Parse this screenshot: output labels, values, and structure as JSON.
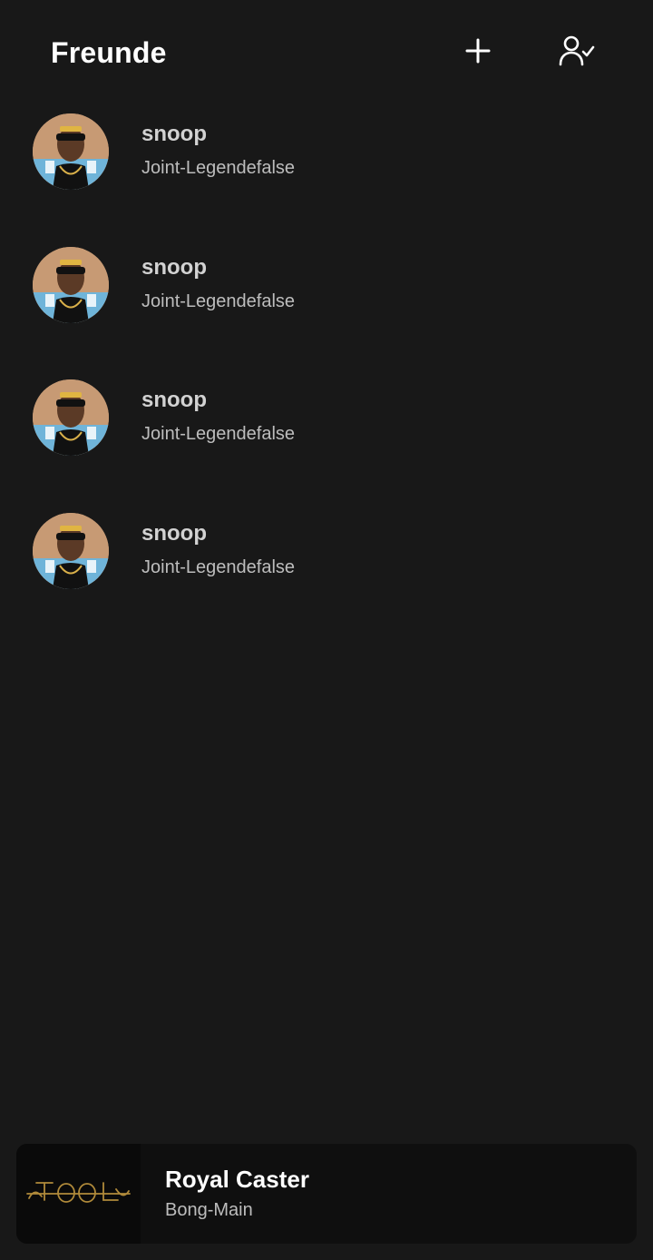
{
  "header": {
    "title": "Freunde",
    "add_icon": "plus-icon",
    "friends_icon": "user-check-icon"
  },
  "friends": [
    {
      "name": "snoop",
      "status": "Joint-Legendefalse",
      "avatar_icon": "avatar-photo"
    },
    {
      "name": "snoop",
      "status": "Joint-Legendefalse",
      "avatar_icon": "avatar-photo"
    },
    {
      "name": "snoop",
      "status": "Joint-Legendefalse",
      "avatar_icon": "avatar-photo"
    },
    {
      "name": "snoop",
      "status": "Joint-Legendefalse",
      "avatar_icon": "avatar-photo"
    }
  ],
  "player": {
    "title": "Royal Caster",
    "artist": "Bong-Main",
    "cover_logo": "TOOL"
  },
  "colors": {
    "background": "#181818",
    "player_background": "#0f0f0f",
    "text_primary": "#ffffff",
    "text_secondary": "#bdbdbd",
    "logo_gold": "#b08a3a"
  }
}
